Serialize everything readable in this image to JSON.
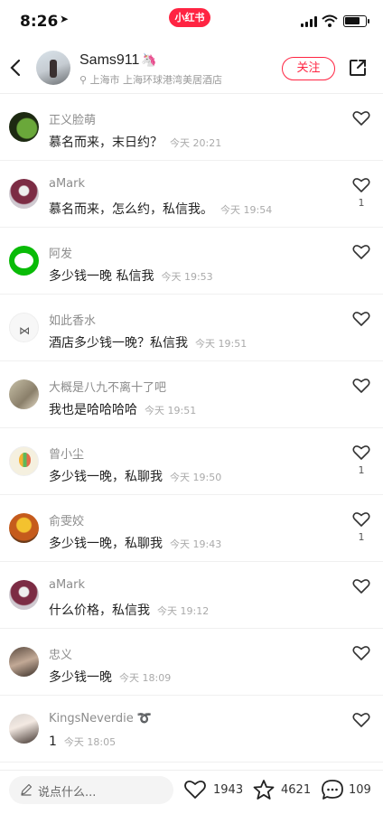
{
  "status_bar": {
    "time": "8:26",
    "app_badge": "小红书",
    "battery_percent": 80
  },
  "header": {
    "user_name": "Sams911",
    "location": "上海市 上海环球港湾美居酒店",
    "follow_label": "关注"
  },
  "comments": [
    {
      "name": "正义脸萌",
      "text": "慕名而来，末日约？",
      "time": "今天 20:21",
      "likes": ""
    },
    {
      "name": "aMark",
      "text": "慕名而来，怎么约，私信我。",
      "time": "今天 19:54",
      "likes": "1"
    },
    {
      "name": "阿发",
      "text": "多少钱一晚 私信我",
      "time": "今天 19:53",
      "likes": ""
    },
    {
      "name": "如此香水",
      "text": "酒店多少钱一晚？私信我",
      "time": "今天 19:51",
      "likes": ""
    },
    {
      "name": "大概是八九不离十了吧",
      "text": "我也是哈哈哈哈",
      "time": "今天 19:51",
      "likes": ""
    },
    {
      "name": "曾小尘",
      "text": "多少钱一晚，私聊我",
      "time": "今天 19:50",
      "likes": "1"
    },
    {
      "name": "俞雯姣",
      "text": "多少钱一晚，私聊我",
      "time": "今天 19:43",
      "likes": "1"
    },
    {
      "name": "aMark",
      "text": "什么价格，私信我",
      "time": "今天 19:12",
      "likes": ""
    },
    {
      "name": "忠义",
      "text": "多少钱一晚",
      "time": "今天 18:09",
      "likes": ""
    },
    {
      "name": "KingsNeverdie ➰",
      "text": "1",
      "time": "今天 18:05",
      "likes": ""
    }
  ],
  "bottom_bar": {
    "input_placeholder": "说点什么...",
    "likes": "1943",
    "favorites": "4621",
    "comments": "109"
  },
  "colors": {
    "accent": "#ff2442"
  }
}
